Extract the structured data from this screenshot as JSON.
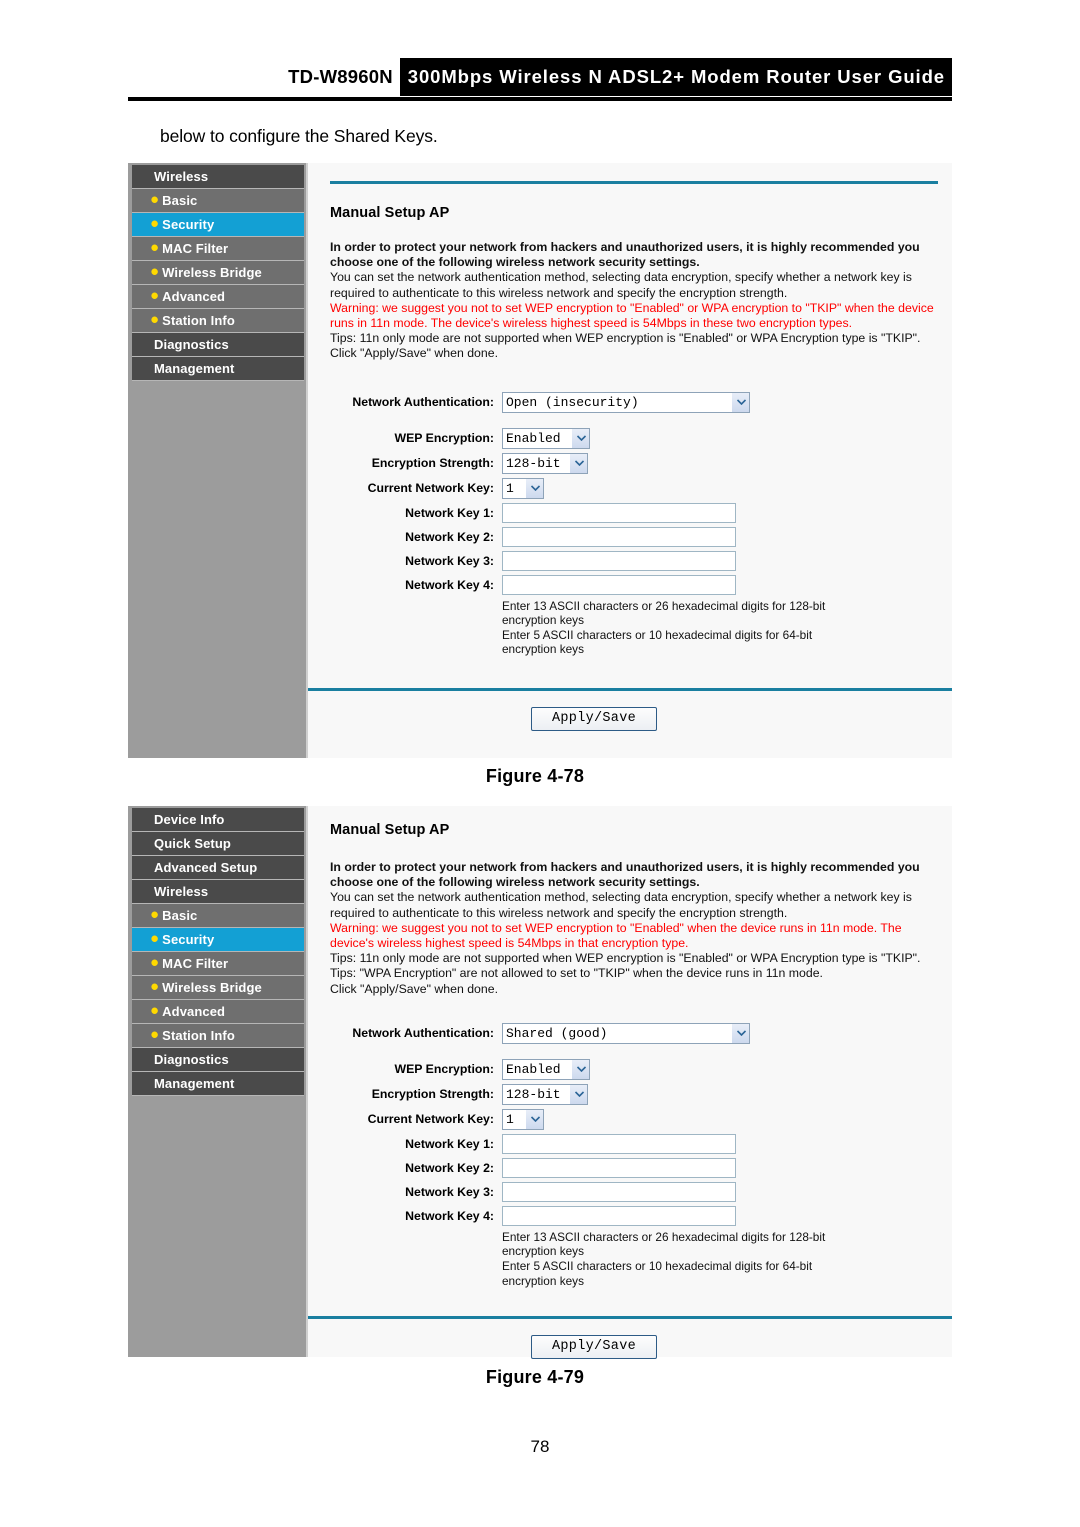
{
  "header": {
    "model": "TD-W8960N",
    "title": "300Mbps Wireless N ADSL2+ Modem Router User Guide"
  },
  "intro_text": "below to configure the Shared Keys.",
  "page_number": "78",
  "figures": [
    {
      "caption": "Figure 4-78",
      "sidebar": [
        {
          "label": "Wireless",
          "type": "top",
          "active": false
        },
        {
          "label": "Basic",
          "type": "sub",
          "active": false
        },
        {
          "label": "Security",
          "type": "sub",
          "active": true
        },
        {
          "label": "MAC Filter",
          "type": "sub",
          "active": false
        },
        {
          "label": "Wireless Bridge",
          "type": "sub",
          "active": false
        },
        {
          "label": "Advanced",
          "type": "sub",
          "active": false
        },
        {
          "label": "Station Info",
          "type": "sub",
          "active": false
        },
        {
          "label": "Diagnostics",
          "type": "top",
          "active": false
        },
        {
          "label": "Management",
          "type": "top",
          "active": false
        }
      ],
      "section_title": "Manual Setup AP",
      "paragraphs": [
        "In order to protect your network from hackers and unauthorized users, it is highly recommended you choose one of the following wireless network security settings.",
        "You can set the network authentication method, selecting data encryption, specify whether a network key is required to authenticate to this wireless network and specify the encryption strength.",
        "Warning: we suggest you not to set WEP encryption to \"Enabled\" or WPA encryption to \"TKIP\" when the device runs in 11n mode. The device's wireless highest speed is 54Mbps in these two encryption types.",
        "Tips: 11n only mode are not supported when WEP encryption is \"Enabled\" or WPA Encryption type is \"TKIP\".",
        "Click \"Apply/Save\" when done."
      ],
      "form": {
        "auth_label": "Network Authentication:",
        "auth_value": "Open (insecurity)",
        "wep_label": "WEP Encryption:",
        "wep_value": "Enabled",
        "strength_label": "Encryption Strength:",
        "strength_value": "128-bit",
        "current_key_label": "Current Network Key:",
        "current_key_value": "1",
        "key1_label": "Network Key 1:",
        "key1_value": "",
        "key2_label": "Network Key 2:",
        "key2_value": "",
        "key3_label": "Network Key 3:",
        "key3_value": "",
        "key4_label": "Network Key 4:",
        "key4_value": "",
        "hint_line1": "Enter 13 ASCII characters or 26 hexadecimal digits for 128-bit",
        "hint_line2": "encryption keys",
        "hint_line3": "Enter 5 ASCII characters or 10 hexadecimal digits for 64-bit",
        "hint_line4": "encryption keys",
        "apply_label": "Apply/Save"
      }
    },
    {
      "caption": "Figure 4-79",
      "sidebar": [
        {
          "label": "Device Info",
          "type": "top",
          "active": false
        },
        {
          "label": "Quick Setup",
          "type": "top",
          "active": false
        },
        {
          "label": "Advanced Setup",
          "type": "top",
          "active": false
        },
        {
          "label": "Wireless",
          "type": "top",
          "active": false
        },
        {
          "label": "Basic",
          "type": "sub",
          "active": false
        },
        {
          "label": "Security",
          "type": "sub",
          "active": true
        },
        {
          "label": "MAC Filter",
          "type": "sub",
          "active": false
        },
        {
          "label": "Wireless Bridge",
          "type": "sub",
          "active": false
        },
        {
          "label": "Advanced",
          "type": "sub",
          "active": false
        },
        {
          "label": "Station Info",
          "type": "sub",
          "active": false
        },
        {
          "label": "Diagnostics",
          "type": "top",
          "active": false
        },
        {
          "label": "Management",
          "type": "top",
          "active": false
        }
      ],
      "section_title": "Manual Setup AP",
      "paragraphs": [
        "In order to protect your network from hackers and unauthorized users, it is highly recommended you choose one of the following wireless network security settings.",
        "You can set the network authentication method, selecting data encryption, specify whether a network key is required to authenticate to this wireless network and specify the encryption strength.",
        "Warning: we suggest you not to set WEP encryption to \"Enabled\" when the device runs in 11n mode. The device's wireless highest speed is 54Mbps in that encryption type.",
        "Tips: 11n only mode are not supported when WEP encryption is \"Enabled\" or WPA Encryption type is \"TKIP\".",
        "Tips: \"WPA Encryption\" are not allowed to set to \"TKIP\" when the device runs in 11n mode.",
        "Click \"Apply/Save\" when done."
      ],
      "form": {
        "auth_label": "Network Authentication:",
        "auth_value": "Shared (good)",
        "wep_label": "WEP Encryption:",
        "wep_value": "Enabled",
        "strength_label": "Encryption Strength:",
        "strength_value": "128-bit",
        "current_key_label": "Current Network Key:",
        "current_key_value": "1",
        "key1_label": "Network Key 1:",
        "key1_value": "",
        "key2_label": "Network Key 2:",
        "key2_value": "",
        "key3_label": "Network Key 3:",
        "key3_value": "",
        "key4_label": "Network Key 4:",
        "key4_value": "",
        "hint_line1": "Enter 13 ASCII characters or 26 hexadecimal digits for 128-bit",
        "hint_line2": "encryption keys",
        "hint_line3": "Enter 5 ASCII characters or 10 hexadecimal digits for 64-bit",
        "hint_line4": "encryption keys",
        "apply_label": "Apply/Save"
      }
    }
  ],
  "colors": {
    "accent_rule": "#1a7fa0",
    "active_nav": "#13a0d4",
    "bullet": "#ffd900",
    "warning_text": "#ff0000"
  }
}
